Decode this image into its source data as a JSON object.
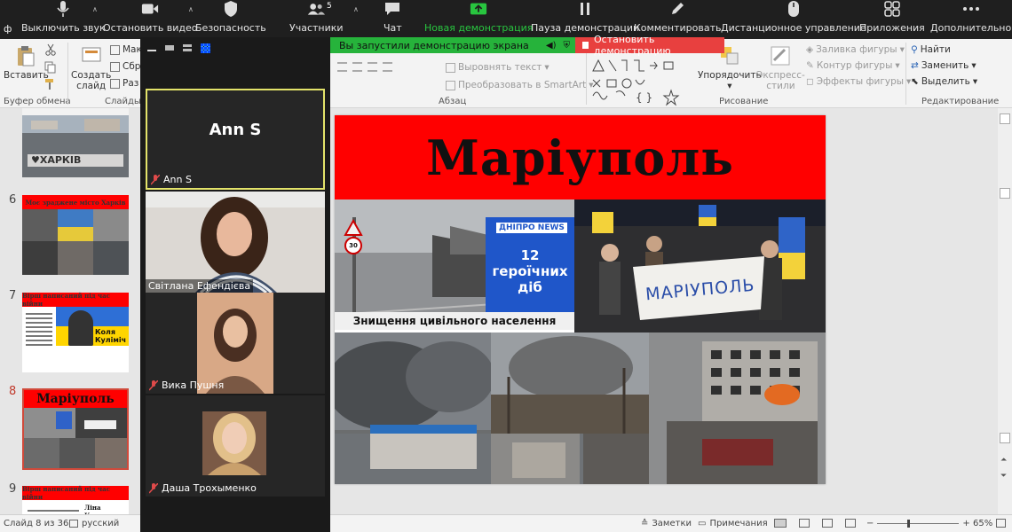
{
  "zoom_toolbar": {
    "mute": "Выключить звук",
    "stop_video": "Остановить видео",
    "security": "Безопасность",
    "participants": "Участники",
    "participants_count": "5",
    "chat": "Чат",
    "new_share": "Новая демонстрация",
    "pause_share": "Пауза демонстрации",
    "annotate": "Комментировать",
    "remote_control": "Дистанционное управление",
    "apps": "Приложения",
    "more": "Дополнительно"
  },
  "share_banner": {
    "notice": "Вы запустили демонстрацию экрана",
    "stop": "Остановить демонстрацию"
  },
  "ribbon": {
    "paste": "Вставить",
    "new_slide_line1": "Создать",
    "new_slide_line2": "слайд",
    "layout_partial": "Мак",
    "reset_partial": "Сбр",
    "section_partial": "Раз",
    "clipboard_group": "Буфер обмена",
    "slides_group": "Слайды",
    "align_text": "Выровнять текст",
    "smartart": "Преобразовать в SmartArt",
    "paragraph_group": "Абзац",
    "arrange": "Упорядочить",
    "express_styles_line1": "Экспресс-",
    "express_styles_line2": "стили",
    "shape_fill": "Заливка фигуры",
    "shape_outline": "Контур фигуры",
    "shape_effects": "Эффекты фигуры",
    "drawing_group": "Рисование",
    "find": "Найти",
    "replace": "Заменить",
    "select": "Выделить",
    "editing_group": "Редактирование"
  },
  "thumbnails": [
    {
      "num": "",
      "caption": "♥ХАРКІВ"
    },
    {
      "num": "6",
      "title": "Моє зраджене місто Харків"
    },
    {
      "num": "7",
      "title": "Вірш написаний під час війни",
      "author_line1": "Коля",
      "author_line2": "Куліміч"
    },
    {
      "num": "8",
      "title": "Маріуполь",
      "active": true
    },
    {
      "num": "9",
      "title": "Вірш написаний під час війни",
      "author": "Ліна Костенко"
    }
  ],
  "gallery": {
    "participants": [
      {
        "name": "Ann S",
        "display": "Ann S"
      },
      {
        "name": "Світлана Ефендієва"
      },
      {
        "name": "Вика Пушня"
      },
      {
        "name": "Даша Трохыменко"
      }
    ]
  },
  "slide": {
    "title": "Маріуполь",
    "news_brand": "ДНІПРО NEWS",
    "news_line1": "12 героїчних",
    "news_line2": "діб",
    "caption": "Знищення цивільного населення",
    "banner": "МАРІУПОЛЬ",
    "speed_sign": "30"
  },
  "statusbar": {
    "slide_info": "Слайд 8 из 36",
    "language": "русский",
    "notes": "Заметки",
    "comments": "Примечания",
    "zoom": "65%"
  },
  "colors": {
    "zoom_bg": "#1f1f1f",
    "share_green": "#26b33b",
    "stop_red": "#e8403f",
    "slide_title_red": "#ff0000",
    "active_speaker": "#e3e36a"
  }
}
